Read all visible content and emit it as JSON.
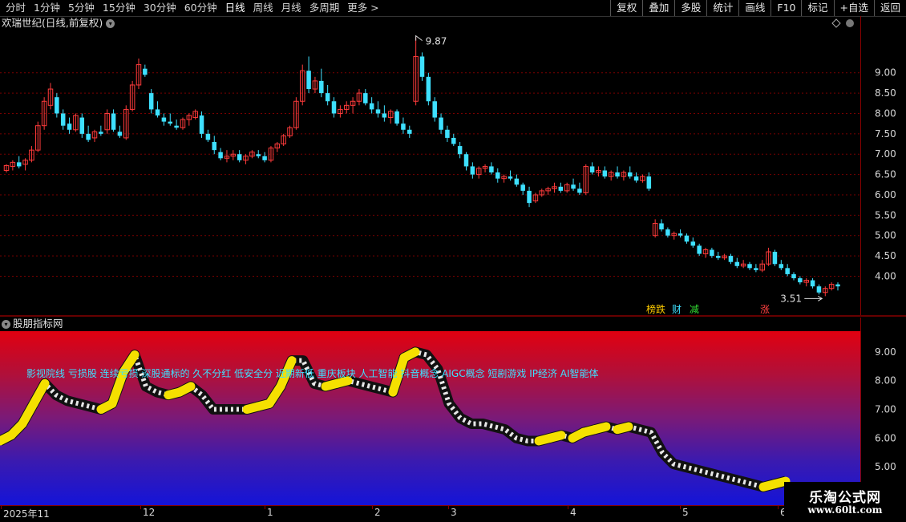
{
  "toolbar": {
    "periods": [
      "分时",
      "1分钟",
      "5分钟",
      "15分钟",
      "30分钟",
      "60分钟",
      "日线",
      "周线",
      "月线",
      "多周期",
      "更多 >"
    ],
    "active_period": "日线",
    "tools": [
      "复权",
      "叠加",
      "多股",
      "统计",
      "画线",
      "F10",
      "标记",
      "+自选",
      "返回"
    ]
  },
  "main_chart": {
    "title": "欢瑞世纪(日线,前复权)",
    "price_ticks": [
      "9.00",
      "8.50",
      "8.00",
      "7.50",
      "7.00",
      "6.50",
      "6.00",
      "5.50",
      "5.00",
      "4.50",
      "4.00"
    ],
    "high_marker": "9.87",
    "low_marker": "3.51",
    "event_tags": [
      {
        "text": "榜跌",
        "color": "#ffcc00"
      },
      {
        "text": "财",
        "color": "#3ee0ff"
      },
      {
        "text": "减",
        "color": "#33dd33"
      },
      {
        "text": "涨",
        "color": "#ff4040"
      }
    ],
    "colors": {
      "up": "#ff3b3b",
      "down": "#3ee0ff",
      "grid": "#7a0000"
    }
  },
  "indicator": {
    "title": "股朋指标网",
    "concepts": "影视院线 亏损股 连续亏损 深股通标的 久不分红 低安全分 近期新低 重庆板块 人工智能 抖音概念 AIGC概念 短剧游戏 IP经济 AI智能体",
    "axis_ticks": [
      "9.00",
      "8.00",
      "7.00",
      "6.00",
      "5.00"
    ]
  },
  "date_axis": [
    "2025年11",
    "12",
    "1",
    "2",
    "3",
    "4",
    "5",
    "6"
  ],
  "watermark": {
    "title": "乐淘公式网",
    "url": "www.60lt.com"
  },
  "chart_data": {
    "type": "candlestick",
    "ylim": [
      3.3,
      10.0
    ],
    "candles": [
      [
        6.6,
        6.75,
        6.55,
        6.72
      ],
      [
        6.7,
        6.85,
        6.6,
        6.8
      ],
      [
        6.8,
        6.95,
        6.65,
        6.7
      ],
      [
        6.75,
        6.9,
        6.6,
        6.85
      ],
      [
        6.85,
        7.2,
        6.8,
        7.1
      ],
      [
        7.1,
        7.8,
        7.05,
        7.7
      ],
      [
        7.7,
        8.4,
        7.6,
        8.3
      ],
      [
        8.2,
        8.75,
        8.1,
        8.6
      ],
      [
        8.4,
        8.5,
        7.9,
        8.0
      ],
      [
        8.0,
        8.1,
        7.6,
        7.7
      ],
      [
        7.75,
        7.9,
        7.5,
        7.6
      ],
      [
        7.6,
        8.0,
        7.55,
        7.95
      ],
      [
        7.9,
        8.0,
        7.4,
        7.5
      ],
      [
        7.5,
        7.7,
        7.3,
        7.35
      ],
      [
        7.4,
        7.6,
        7.3,
        7.55
      ],
      [
        7.55,
        7.7,
        7.45,
        7.5
      ],
      [
        7.6,
        8.1,
        7.5,
        8.0
      ],
      [
        8.0,
        8.1,
        7.55,
        7.6
      ],
      [
        7.55,
        7.7,
        7.4,
        7.45
      ],
      [
        7.4,
        8.2,
        7.35,
        8.1
      ],
      [
        8.1,
        8.8,
        8.05,
        8.7
      ],
      [
        8.7,
        9.35,
        8.6,
        9.2
      ],
      [
        9.1,
        9.2,
        8.9,
        8.95
      ],
      [
        8.5,
        8.6,
        8.0,
        8.1
      ],
      [
        8.1,
        8.3,
        7.9,
        7.95
      ],
      [
        7.9,
        8.0,
        7.7,
        7.8
      ],
      [
        7.8,
        8.0,
        7.7,
        7.75
      ],
      [
        7.7,
        7.85,
        7.6,
        7.65
      ],
      [
        7.65,
        7.9,
        7.6,
        7.85
      ],
      [
        7.85,
        8.0,
        7.7,
        7.95
      ],
      [
        7.9,
        8.1,
        7.85,
        8.05
      ],
      [
        7.95,
        8.05,
        7.4,
        7.5
      ],
      [
        7.5,
        7.6,
        7.3,
        7.35
      ],
      [
        7.3,
        7.45,
        7.0,
        7.1
      ],
      [
        7.05,
        7.15,
        6.85,
        6.9
      ],
      [
        6.9,
        7.1,
        6.8,
        6.95
      ],
      [
        6.95,
        7.1,
        6.85,
        7.0
      ],
      [
        7.0,
        7.1,
        6.8,
        6.85
      ],
      [
        6.85,
        7.0,
        6.75,
        6.95
      ],
      [
        6.95,
        7.1,
        6.9,
        7.05
      ],
      [
        7.0,
        7.1,
        6.9,
        6.95
      ],
      [
        6.95,
        7.05,
        6.8,
        6.85
      ],
      [
        6.85,
        7.2,
        6.8,
        7.15
      ],
      [
        7.15,
        7.3,
        7.05,
        7.25
      ],
      [
        7.25,
        7.5,
        7.2,
        7.45
      ],
      [
        7.45,
        7.7,
        7.4,
        7.65
      ],
      [
        7.65,
        8.4,
        7.6,
        8.3
      ],
      [
        8.3,
        9.2,
        8.2,
        9.05
      ],
      [
        9.05,
        9.4,
        8.5,
        8.6
      ],
      [
        8.6,
        8.9,
        8.5,
        8.8
      ],
      [
        8.8,
        9.1,
        8.4,
        8.5
      ],
      [
        8.5,
        8.7,
        8.2,
        8.3
      ],
      [
        8.3,
        8.4,
        7.9,
        8.0
      ],
      [
        8.0,
        8.2,
        7.9,
        8.1
      ],
      [
        8.1,
        8.3,
        8.0,
        8.2
      ],
      [
        8.2,
        8.4,
        8.0,
        8.3
      ],
      [
        8.3,
        8.6,
        8.2,
        8.5
      ],
      [
        8.5,
        8.6,
        8.2,
        8.25
      ],
      [
        8.25,
        8.4,
        8.0,
        8.1
      ],
      [
        8.1,
        8.3,
        7.9,
        8.0
      ],
      [
        8.0,
        8.2,
        7.8,
        7.9
      ],
      [
        7.9,
        8.1,
        7.75,
        8.05
      ],
      [
        8.05,
        8.1,
        7.7,
        7.75
      ],
      [
        7.75,
        7.9,
        7.5,
        7.6
      ],
      [
        7.6,
        7.7,
        7.4,
        7.5
      ],
      [
        8.3,
        9.87,
        8.2,
        9.4
      ],
      [
        9.4,
        9.5,
        8.8,
        8.9
      ],
      [
        8.9,
        9.0,
        8.2,
        8.3
      ],
      [
        8.3,
        8.4,
        7.8,
        7.9
      ],
      [
        7.9,
        8.0,
        7.5,
        7.6
      ],
      [
        7.6,
        7.7,
        7.3,
        7.4
      ],
      [
        7.4,
        7.5,
        7.2,
        7.25
      ],
      [
        7.2,
        7.3,
        6.9,
        7.0
      ],
      [
        7.0,
        7.05,
        6.6,
        6.7
      ],
      [
        6.7,
        6.8,
        6.4,
        6.5
      ],
      [
        6.5,
        6.7,
        6.4,
        6.65
      ],
      [
        6.65,
        6.75,
        6.55,
        6.7
      ],
      [
        6.7,
        6.8,
        6.5,
        6.55
      ],
      [
        6.55,
        6.65,
        6.3,
        6.4
      ],
      [
        6.4,
        6.5,
        6.3,
        6.45
      ],
      [
        6.45,
        6.6,
        6.35,
        6.4
      ],
      [
        6.4,
        6.5,
        6.2,
        6.25
      ],
      [
        6.25,
        6.3,
        6.0,
        6.1
      ],
      [
        6.1,
        6.2,
        5.7,
        5.8
      ],
      [
        5.85,
        6.05,
        5.8,
        6.0
      ],
      [
        6.0,
        6.15,
        5.95,
        6.1
      ],
      [
        6.1,
        6.2,
        6.0,
        6.15
      ],
      [
        6.15,
        6.3,
        6.05,
        6.2
      ],
      [
        6.2,
        6.3,
        6.05,
        6.1
      ],
      [
        6.1,
        6.3,
        6.05,
        6.25
      ],
      [
        6.25,
        6.4,
        6.1,
        6.15
      ],
      [
        6.15,
        6.3,
        6.0,
        6.05
      ],
      [
        6.05,
        6.75,
        6.0,
        6.7
      ],
      [
        6.7,
        6.8,
        6.5,
        6.55
      ],
      [
        6.55,
        6.7,
        6.45,
        6.6
      ],
      [
        6.6,
        6.7,
        6.4,
        6.45
      ],
      [
        6.45,
        6.6,
        6.35,
        6.55
      ],
      [
        6.55,
        6.7,
        6.4,
        6.45
      ],
      [
        6.45,
        6.6,
        6.35,
        6.55
      ],
      [
        6.55,
        6.7,
        6.4,
        6.45
      ],
      [
        6.45,
        6.55,
        6.3,
        6.35
      ],
      [
        6.35,
        6.5,
        6.3,
        6.45
      ],
      [
        6.45,
        6.55,
        6.1,
        6.15
      ],
      [
        5.0,
        5.4,
        4.95,
        5.3
      ],
      [
        5.3,
        5.4,
        5.1,
        5.15
      ],
      [
        5.15,
        5.2,
        4.95,
        5.0
      ],
      [
        5.0,
        5.1,
        4.9,
        5.05
      ],
      [
        5.05,
        5.15,
        4.95,
        5.0
      ],
      [
        5.0,
        5.05,
        4.8,
        4.85
      ],
      [
        4.85,
        4.95,
        4.7,
        4.75
      ],
      [
        4.75,
        4.8,
        4.5,
        4.55
      ],
      [
        4.55,
        4.7,
        4.45,
        4.65
      ],
      [
        4.65,
        4.7,
        4.45,
        4.5
      ],
      [
        4.5,
        4.6,
        4.4,
        4.45
      ],
      [
        4.45,
        4.55,
        4.4,
        4.5
      ],
      [
        4.5,
        4.55,
        4.3,
        4.35
      ],
      [
        4.35,
        4.45,
        4.2,
        4.25
      ],
      [
        4.25,
        4.4,
        4.2,
        4.3
      ],
      [
        4.3,
        4.35,
        4.15,
        4.2
      ],
      [
        4.2,
        4.3,
        4.1,
        4.15
      ],
      [
        4.15,
        4.4,
        4.1,
        4.3
      ],
      [
        4.3,
        4.7,
        4.25,
        4.6
      ],
      [
        4.6,
        4.65,
        4.25,
        4.3
      ],
      [
        4.3,
        4.4,
        4.15,
        4.2
      ],
      [
        4.2,
        4.3,
        4.0,
        4.05
      ],
      [
        4.05,
        4.1,
        3.9,
        3.95
      ],
      [
        3.95,
        4.0,
        3.8,
        3.85
      ],
      [
        3.85,
        3.95,
        3.75,
        3.9
      ],
      [
        3.9,
        3.95,
        3.7,
        3.75
      ],
      [
        3.75,
        3.8,
        3.55,
        3.6
      ],
      [
        3.6,
        3.75,
        3.51,
        3.7
      ],
      [
        3.7,
        3.85,
        3.65,
        3.8
      ],
      [
        3.8,
        3.85,
        3.65,
        3.75
      ]
    ],
    "indicator_line": [
      5.9,
      6.1,
      6.5,
      7.2,
      7.9,
      7.5,
      7.3,
      7.2,
      7.1,
      7.0,
      7.2,
      8.3,
      8.9,
      7.8,
      7.6,
      7.5,
      7.6,
      7.8,
      7.5,
      7.0,
      7.0,
      7.0,
      7.0,
      7.1,
      7.2,
      7.8,
      8.7,
      8.7,
      7.9,
      7.8,
      7.9,
      8.0,
      7.9,
      7.8,
      7.7,
      7.6,
      8.8,
      9.0,
      8.9,
      8.4,
      7.2,
      6.7,
      6.5,
      6.5,
      6.4,
      6.3,
      6.0,
      5.9,
      5.9,
      6.0,
      6.1,
      6.0,
      6.2,
      6.3,
      6.4,
      6.3,
      6.4,
      6.3,
      6.2,
      5.5,
      5.1,
      5.0,
      4.9,
      4.8,
      4.7,
      4.6,
      4.5,
      4.4,
      4.3,
      4.4,
      4.5
    ],
    "indicator_ylim": [
      4.0,
      9.5
    ]
  }
}
